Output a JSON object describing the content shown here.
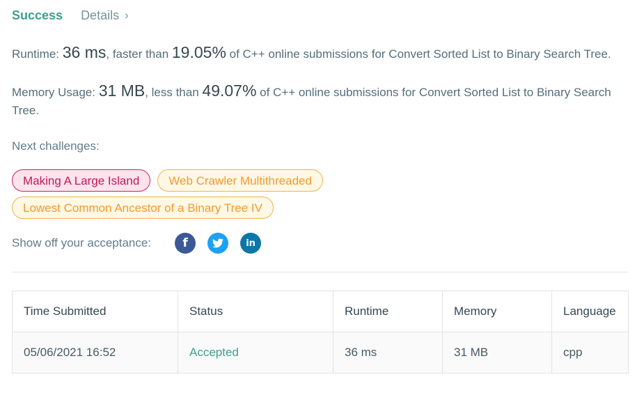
{
  "header": {
    "success_label": "Success",
    "details_label": "Details",
    "details_chevron": "›"
  },
  "runtime": {
    "label": "Runtime: ",
    "value": "36 ms",
    "mid": ", faster than ",
    "percent": "19.05%",
    "suffix": " of C++ online submissions for Convert Sorted List to Binary Search Tree."
  },
  "memory": {
    "label": "Memory Usage: ",
    "value": "31 MB",
    "mid": ", less than ",
    "percent": "49.07%",
    "suffix": " of C++ online submissions for Convert Sorted List to Binary Search Tree."
  },
  "next": {
    "label": "Next challenges:",
    "challenges": [
      {
        "title": "Making A Large Island",
        "difficulty": "hard"
      },
      {
        "title": "Web Crawler Multithreaded",
        "difficulty": "medium"
      },
      {
        "title": "Lowest Common Ancestor of a Binary Tree IV",
        "difficulty": "medium"
      }
    ]
  },
  "share": {
    "label": "Show off your acceptance:",
    "icons": [
      "facebook-icon",
      "twitter-icon",
      "linkedin-icon"
    ]
  },
  "colors": {
    "success": "#3c9f91",
    "hard_chip": "#d81b60",
    "medium_chip": "#f0b24f",
    "facebook": "#3b5998",
    "twitter": "#1da1f2",
    "linkedin": "#0e76a8"
  },
  "table": {
    "headers": [
      "Time Submitted",
      "Status",
      "Runtime",
      "Memory",
      "Language"
    ],
    "rows": [
      [
        "05/06/2021 16:52",
        "Accepted",
        "36 ms",
        "31 MB",
        "cpp"
      ]
    ]
  }
}
